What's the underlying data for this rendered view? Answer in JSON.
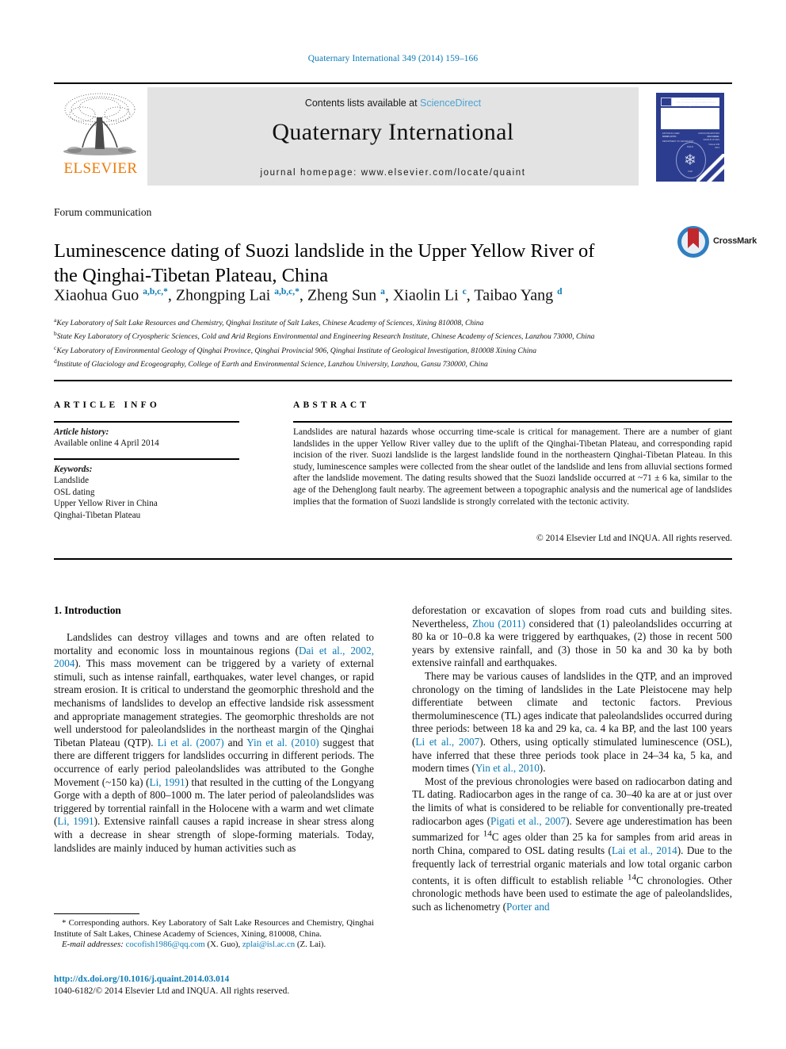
{
  "running_head": "Quaternary International 349 (2014) 159–166",
  "masthead": {
    "publisher": "ELSEVIER",
    "contents_prefix": "Contents lists available at ",
    "contents_link": "ScienceDirect",
    "journal_name": "Quaternary International",
    "homepage": "journal homepage: www.elsevier.com/locate/quaint"
  },
  "article": {
    "type": "Forum communication",
    "title": "Luminescence dating of Suozi landslide in the Upper Yellow River of the Qinghai-Tibetan Plateau, China",
    "crossmark_label": "CrossMark",
    "authors_html": "Xiaohua Guo <sup>a,b,c,</sup><sup>*</sup>, Zhongping Lai <sup>a,b,c,</sup><sup>*</sup>, Zheng Sun <sup>a</sup>, Xiaolin Li <sup>c</sup>, Taibao Yang <sup>d</sup>",
    "affiliations": [
      {
        "marker": "a",
        "text": "Key Laboratory of Salt Lake Resources and Chemistry, Qinghai Institute of Salt Lakes, Chinese Academy of Sciences, Xining 810008, China"
      },
      {
        "marker": "b",
        "text": "State Key Laboratory of Cryospheric Sciences, Cold and Arid Regions Environmental and Engineering Research Institute, Chinese Academy of Sciences, Lanzhou 73000, China"
      },
      {
        "marker": "c",
        "text": "Key Laboratory of Environmental Geology of Qinghai Province, Qinghai Provincial 906, Qinghai Institute of Geological Investigation, 810008 Xining China"
      },
      {
        "marker": "d",
        "text": "Institute of Glaciology and Ecogeography, College of Earth and Environmental Science, Lanzhou University, Lanzhou, Gansu 730000, China"
      }
    ]
  },
  "article_info": {
    "heading": "ARTICLE INFO",
    "history_label": "Article history:",
    "history_value": "Available online 4 April 2014",
    "keywords_label": "Keywords:",
    "keywords": [
      "Landslide",
      "OSL dating",
      "Upper Yellow River in China",
      "Qinghai-Tibetan Plateau"
    ]
  },
  "abstract": {
    "heading": "ABSTRACT",
    "text": "Landslides are natural hazards whose occurring time-scale is critical for management. There are a number of giant landslides in the upper Yellow River valley due to the uplift of the Qinghai-Tibetan Plateau, and corresponding rapid incision of the river. Suozi landslide is the largest landslide found in the northeastern Qinghai-Tibetan Plateau. In this study, luminescence samples were collected from the shear outlet of the landslide and lens from alluvial sections formed after the landslide movement. The dating results showed that the Suozi landslide occurred at ~71 ± 6 ka, similar to the age of the Dehenglong fault nearby. The agreement between a topographic analysis and the numerical age of landslides implies that the formation of Suozi landslide is strongly correlated with the tectonic activity.",
    "copyright": "© 2014 Elsevier Ltd and INQUA. All rights reserved."
  },
  "body": {
    "section_number_title": "1. Introduction",
    "left_paragraphs": [
      {
        "segments": [
          {
            "t": "Landslides can destroy villages and towns and are often related to mortality and economic loss in mountainous regions (",
            "ref": false
          },
          {
            "t": "Dai et al., 2002, 2004",
            "ref": true
          },
          {
            "t": "). This mass movement can be triggered by a variety of external stimuli, such as intense rainfall, earthquakes, water level changes, or rapid stream erosion. It is critical to understand the geomorphic threshold and the mechanisms of landslides to develop an effective landside risk assessment and appropriate management strategies. The geomorphic thresholds are not well understood for paleolandslides in the northeast margin of the Qinghai Tibetan Plateau (QTP). ",
            "ref": false
          },
          {
            "t": "Li et al. (2007)",
            "ref": true
          },
          {
            "t": " and ",
            "ref": false
          },
          {
            "t": "Yin et al. (2010)",
            "ref": true
          },
          {
            "t": " suggest that there are different triggers for landslides occurring in different periods. The occurrence of early period paleolandslides was attributed to the Gonghe Movement (~150 ka) (",
            "ref": false
          },
          {
            "t": "Li, 1991",
            "ref": true
          },
          {
            "t": ") that resulted in the cutting of the Longyang Gorge with a depth of 800–1000 m. The later period of paleolandslides was triggered by torrential rainfall in the Holocene with a warm and wet climate (",
            "ref": false
          },
          {
            "t": "Li, 1991",
            "ref": true
          },
          {
            "t": "). Extensive rainfall causes a rapid increase in shear stress along with a decrease in shear strength of slope-forming materials. Today, landslides are mainly induced by human activities such as",
            "ref": false
          }
        ]
      }
    ],
    "right_paragraphs": [
      {
        "indent": false,
        "segments": [
          {
            "t": "deforestation or excavation of slopes from road cuts and building sites. Nevertheless, ",
            "ref": false
          },
          {
            "t": "Zhou (2011)",
            "ref": true
          },
          {
            "t": " considered that (1) paleolandslides occurring at 80 ka or 10–0.8 ka were triggered by earthquakes, (2) those in recent 500 years by extensive rainfall, and (3) those in 50 ka and 30 ka by both extensive rainfall and earthquakes.",
            "ref": false
          }
        ]
      },
      {
        "indent": true,
        "segments": [
          {
            "t": "There may be various causes of landslides in the QTP, and an improved chronology on the timing of landslides in the Late Pleistocene may help differentiate between climate and tectonic factors. Previous thermoluminescence (TL) ages indicate that paleolandslides occurred during three periods: between 18 ka and 29 ka, ca. 4 ka BP, and the last 100 years (",
            "ref": false
          },
          {
            "t": "Li et al., 2007",
            "ref": true
          },
          {
            "t": "). Others, using optically stimulated luminescence (OSL), have inferred that these three periods took place in 24–34 ka, 5 ka, and modern times (",
            "ref": false
          },
          {
            "t": "Yin et al., 2010",
            "ref": true
          },
          {
            "t": ").",
            "ref": false
          }
        ]
      },
      {
        "indent": true,
        "segments": [
          {
            "t": "Most of the previous chronologies were based on radiocarbon dating and TL dating. Radiocarbon ages in the range of ca. 30–40 ka are at or just over the limits of what is considered to be reliable for conventionally pre-treated radiocarbon ages (",
            "ref": false
          },
          {
            "t": "Pigati et al., 2007",
            "ref": true
          },
          {
            "t": "). Severe age underestimation has been summarized for <sup>14</sup>C ages older than 25 ka for samples from arid areas in north China, compared to OSL dating results (",
            "ref": false,
            "html": true
          },
          {
            "t": "Lai et al., 2014",
            "ref": true
          },
          {
            "t": "). Due to the frequently lack of terrestrial organic materials and low total organic carbon contents, it is often difficult to establish reliable <sup>14</sup>C chronologies. Other chronologic methods have been used to estimate the age of paleolandslides, such as lichenometry (",
            "ref": false,
            "html": true
          },
          {
            "t": "Porter and",
            "ref": true
          }
        ]
      }
    ]
  },
  "footnote": {
    "corresponding": "* Corresponding authors. Key Laboratory of Salt Lake Resources and Chemistry, Qinghai Institute of Salt Lakes, Chinese Academy of Sciences, Xining, 810008, China.",
    "email_label": "E-mail addresses:",
    "email1": "cocofish1986@qq.com",
    "email1_who": " (X. Guo), ",
    "email2": "zplai@isl.ac.cn",
    "email2_who": " (Z. Lai)."
  },
  "doi": {
    "url": "http://dx.doi.org/10.1016/j.quaint.2014.03.014",
    "issn_line": "1040-6182/© 2014 Elsevier Ltd and INQUA. All rights reserved."
  },
  "colors": {
    "link": "#0b7ab5",
    "band": "#e3e3e3",
    "elsevier_orange": "#ec7a08",
    "cover_blue": "#2c3d8f",
    "crossmark_blue": "#2f7fc1",
    "crossmark_red": "#c1282d"
  }
}
